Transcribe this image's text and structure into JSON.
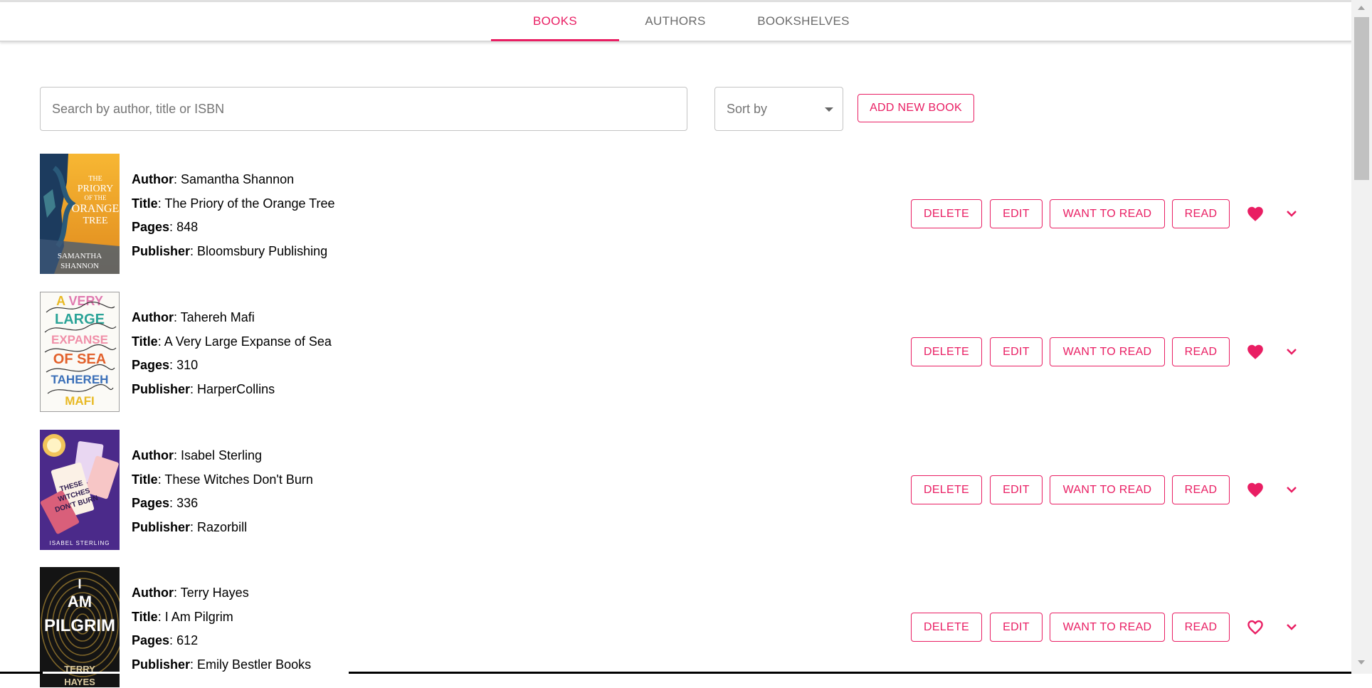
{
  "nav": {
    "tabs": [
      {
        "label": "BOOKS",
        "active": true
      },
      {
        "label": "AUTHORS",
        "active": false
      },
      {
        "label": "BOOKSHELVES",
        "active": false
      }
    ]
  },
  "toolbar": {
    "search_placeholder": "Search by author, title or ISBN",
    "search_value": "",
    "sort_label": "Sort by",
    "add_button": "ADD NEW BOOK"
  },
  "field_labels": {
    "author": "Author",
    "title": "Title",
    "pages": "Pages",
    "publisher": "Publisher"
  },
  "actions": {
    "delete": "DELETE",
    "edit": "EDIT",
    "want_to_read": "WANT TO READ",
    "read": "READ"
  },
  "books": [
    {
      "author": "Samantha Shannon",
      "title": "The Priory of the Orange Tree",
      "pages": "848",
      "publisher": "Bloomsbury Publishing",
      "favorite": true,
      "cover_icon": "book-cover-priory"
    },
    {
      "author": "Tahereh Mafi",
      "title": "A Very Large Expanse of Sea",
      "pages": "310",
      "publisher": "HarperCollins",
      "favorite": true,
      "cover_icon": "book-cover-expanse"
    },
    {
      "author": "Isabel Sterling",
      "title": "These Witches Don't Burn",
      "pages": "336",
      "publisher": "Razorbill",
      "favorite": true,
      "cover_icon": "book-cover-witches"
    },
    {
      "author": "Terry Hayes",
      "title": "I Am Pilgrim",
      "pages": "612",
      "publisher": "Emily Bestler Books",
      "favorite": false,
      "cover_icon": "book-cover-pilgrim"
    }
  ],
  "colors": {
    "accent": "#e91e63",
    "tab_inactive": "#6b6b6b",
    "border": "#c4c4c4"
  }
}
